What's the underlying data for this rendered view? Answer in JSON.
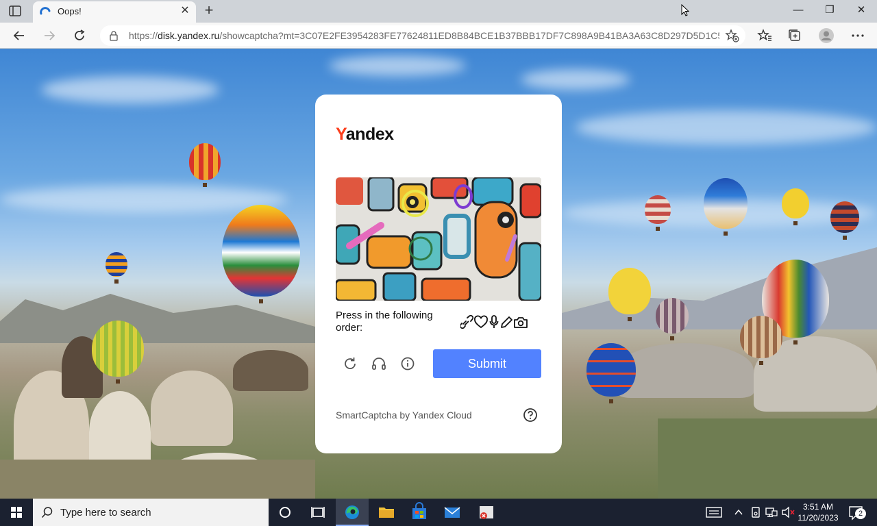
{
  "browser": {
    "tab_title": "Oops!",
    "url_prefix": "https://",
    "url_host": "disk.yandex.ru",
    "url_rest": "/showcaptcha?mt=3C07E2FE3954283FE77624811ED8B84BCE1B37BBB17DF7C898A9B41BA3A63C8D297D5D1C5BF1...",
    "accent": "#0a6cce"
  },
  "captcha": {
    "logo_first": "Y",
    "logo_rest": "andex",
    "prompt": "Press in the following order:",
    "order_icons": [
      "link-icon",
      "heart-icon",
      "microphone-icon",
      "pencil-icon",
      "camera-icon"
    ],
    "submit_label": "Submit",
    "footer": "SmartCaptcha by Yandex Cloud",
    "button_color": "#5282ff"
  },
  "taskbar": {
    "search_placeholder": "Type here to search",
    "time": "3:51 AM",
    "date": "11/20/2023",
    "notification_count": "2"
  }
}
